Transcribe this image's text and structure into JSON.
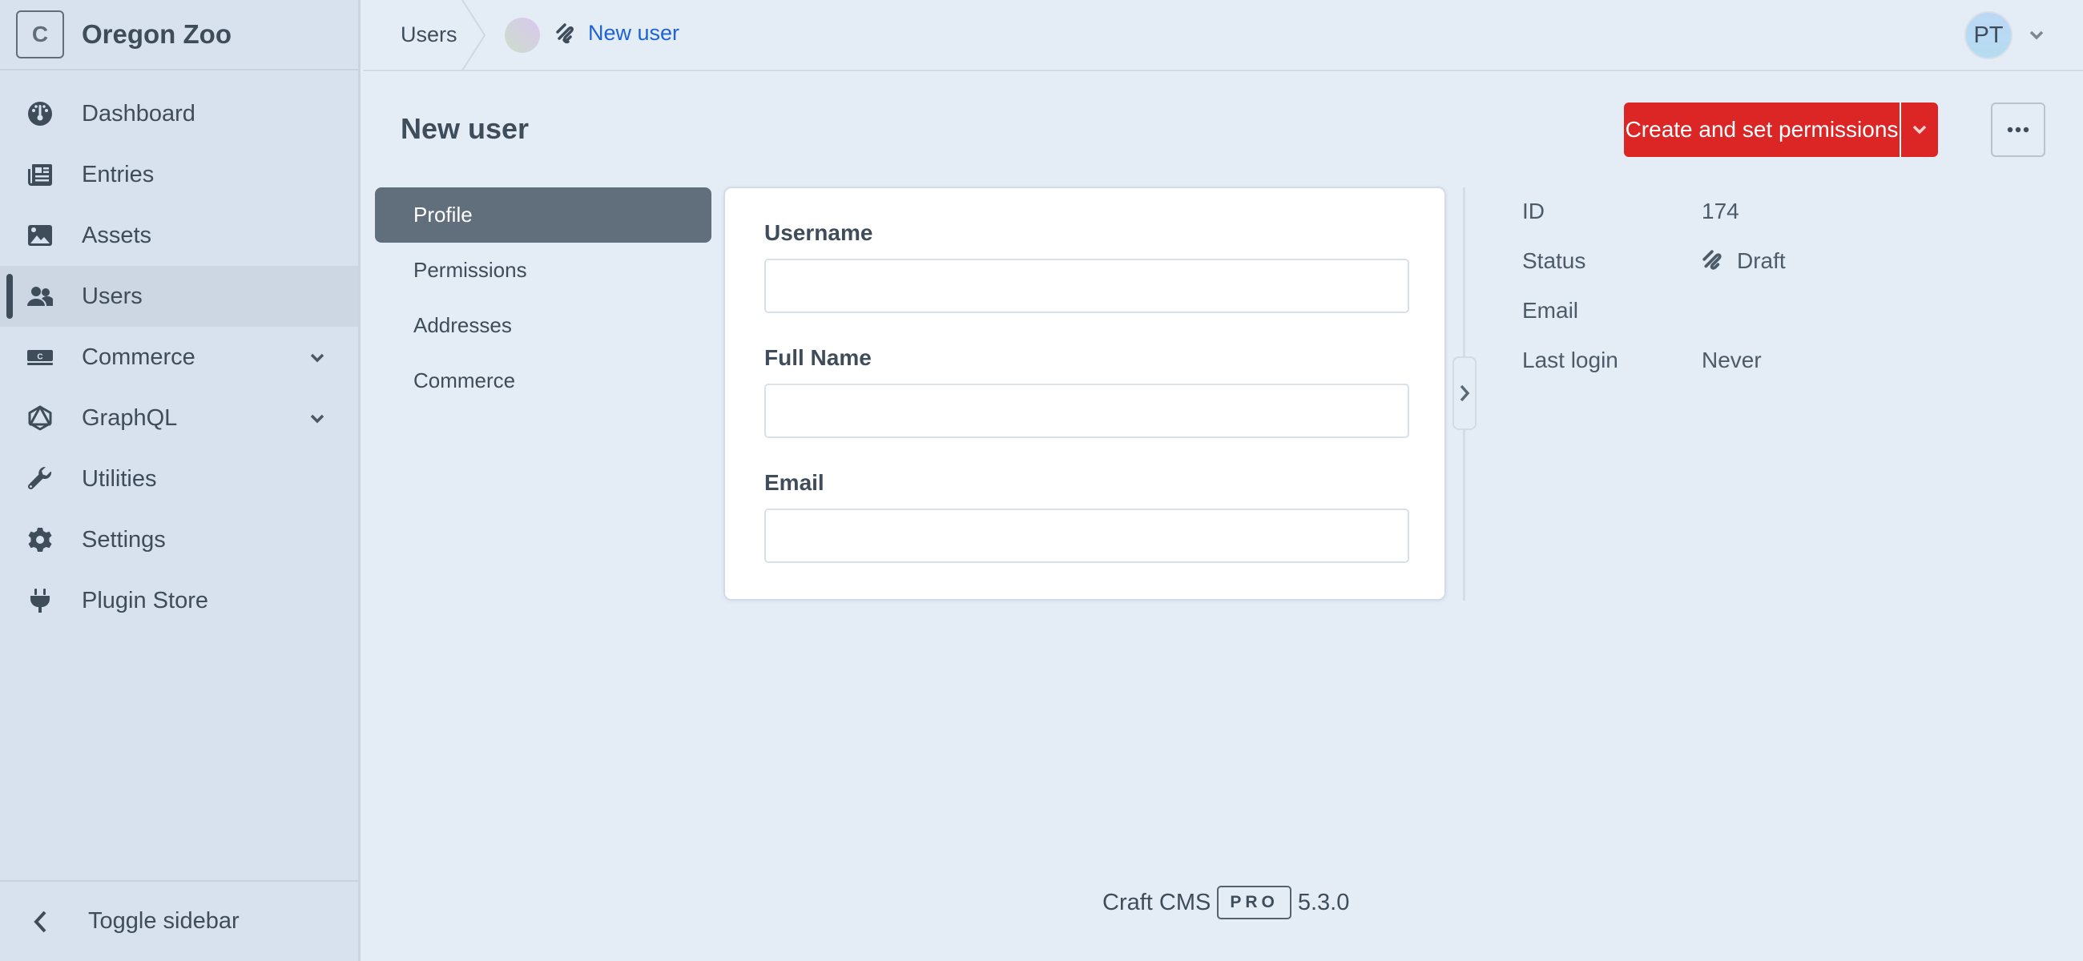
{
  "sidebar": {
    "logo_letter": "C",
    "site_name": "Oregon Zoo",
    "items": [
      {
        "label": "Dashboard",
        "icon": "dashboard-gauge-icon",
        "active": false,
        "has_submenu": false
      },
      {
        "label": "Entries",
        "icon": "newspaper-icon",
        "active": false,
        "has_submenu": false
      },
      {
        "label": "Assets",
        "icon": "image-icon",
        "active": false,
        "has_submenu": false
      },
      {
        "label": "Users",
        "icon": "users-icon",
        "active": true,
        "has_submenu": false
      },
      {
        "label": "Commerce",
        "icon": "commerce-icon",
        "active": false,
        "has_submenu": true
      },
      {
        "label": "GraphQL",
        "icon": "graphql-icon",
        "active": false,
        "has_submenu": true
      },
      {
        "label": "Utilities",
        "icon": "wrench-icon",
        "active": false,
        "has_submenu": false
      },
      {
        "label": "Settings",
        "icon": "gear-icon",
        "active": false,
        "has_submenu": false
      },
      {
        "label": "Plugin Store",
        "icon": "plug-icon",
        "active": false,
        "has_submenu": false
      }
    ],
    "toggle_label": "Toggle sidebar"
  },
  "header": {
    "breadcrumb_parent": "Users",
    "breadcrumb_current": "New user",
    "user_initials": "PT"
  },
  "page": {
    "title": "New user",
    "primary_action": "Create and set permissions",
    "colors": {
      "primary": "#dc2626",
      "link": "#1d63d6",
      "active_tab": "#616e7c"
    }
  },
  "tabs": [
    {
      "label": "Profile",
      "active": true
    },
    {
      "label": "Permissions",
      "active": false
    },
    {
      "label": "Addresses",
      "active": false
    },
    {
      "label": "Commerce",
      "active": false
    }
  ],
  "form": {
    "fields": [
      {
        "label": "Username",
        "value": "",
        "placeholder": ""
      },
      {
        "label": "Full Name",
        "value": "",
        "placeholder": ""
      },
      {
        "label": "Email",
        "value": "",
        "placeholder": ""
      }
    ]
  },
  "meta": {
    "rows": [
      {
        "key": "ID",
        "value": "174"
      },
      {
        "key": "Status",
        "value": "Draft"
      },
      {
        "key": "Email",
        "value": ""
      },
      {
        "key": "Last login",
        "value": "Never"
      }
    ]
  },
  "footer": {
    "product": "Craft CMS",
    "edition": "PRO",
    "version": "5.3.0"
  }
}
